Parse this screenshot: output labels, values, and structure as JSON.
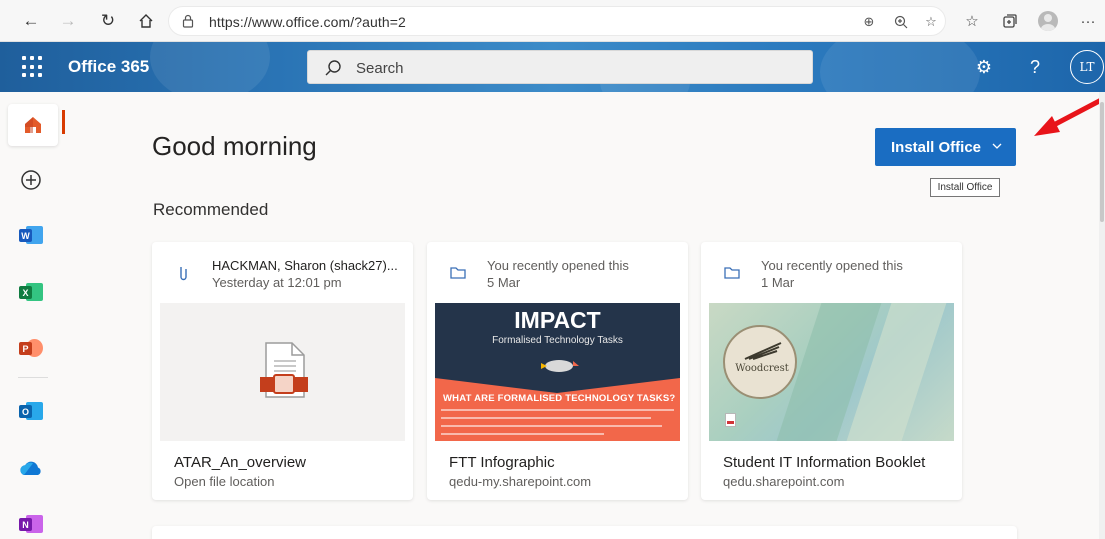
{
  "browser": {
    "url": "https://www.office.com/?auth=2"
  },
  "header": {
    "brand": "Office 365",
    "search_placeholder": "Search",
    "help_label": "?",
    "avatar_initials": "LT"
  },
  "main": {
    "greeting": "Good morning",
    "install_button_label": "Install Office",
    "tooltip": "Install Office",
    "section_title": "Recommended",
    "cards": [
      {
        "icon": "attachment-icon",
        "title": "HACKMAN, Sharon (shack27)...",
        "subtitle": "Yesterday at 12:01 pm",
        "name": "ATAR_An_overview",
        "location": "Open file location"
      },
      {
        "icon": "folder-icon",
        "title": "You recently opened this",
        "subtitle": "5 Mar",
        "name": "FTT Infographic",
        "location": "qedu-my.sharepoint.com",
        "thumb": {
          "heading": "IMPACT",
          "subheading": "Formalised Technology Tasks",
          "question": "WHAT ARE FORMALISED TECHNOLOGY TASKS?"
        }
      },
      {
        "icon": "folder-icon",
        "title": "You recently opened this",
        "subtitle": "1 Mar",
        "name": "Student IT Information Booklet",
        "location": "qedu.sharepoint.com",
        "thumb": {
          "logo_text": "Woodcrest"
        }
      }
    ]
  },
  "colors": {
    "brand_blue": "#1a6dc2",
    "accent_orange": "#d83b01",
    "annotation_red": "#e8141a"
  }
}
